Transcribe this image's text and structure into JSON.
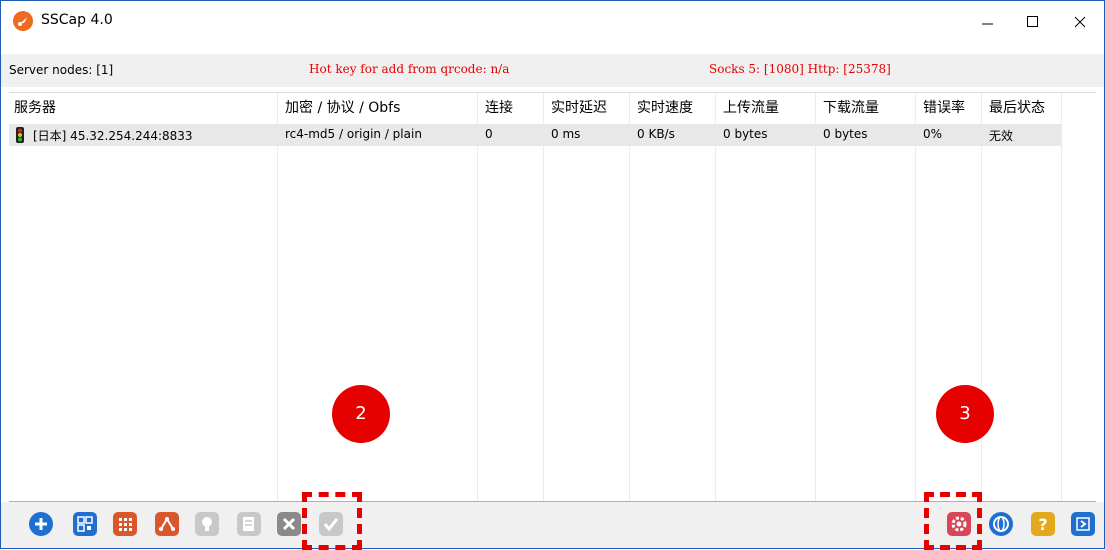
{
  "window": {
    "title": "SSCap 4.0"
  },
  "status": {
    "server_nodes": "Server nodes: [1]",
    "hotkey": "Hot key for add from qrcode: n/a",
    "ports": "Socks 5: [1080] Http: [25378]"
  },
  "table": {
    "columns": [
      "服务器",
      "加密 / 协议 / Obfs",
      "连接",
      "实时延迟",
      "实时速度",
      "上传流量",
      "下载流量",
      "错误率",
      "最后状态"
    ],
    "rows": [
      {
        "server": "[日本] 45.32.254.244:8833",
        "encryption": "rc4-md5 / origin / plain",
        "connections": "0",
        "latency": "0 ms",
        "speed": "0 KB/s",
        "upload": "0 bytes",
        "download": "0 bytes",
        "error_rate": "0%",
        "last_status": "无效"
      }
    ]
  },
  "annotations": {
    "marker_2": "2",
    "marker_3": "3"
  },
  "toolbar": {
    "icons": [
      "add-icon",
      "qrcode-icon",
      "grid-icon",
      "share-icon",
      "bulb-icon",
      "edit-icon",
      "delete-icon",
      "check-icon",
      "settings-icon",
      "globe-icon",
      "help-icon",
      "exit-icon"
    ]
  },
  "colors": {
    "accent": "#1e5fb4",
    "highlight_red": "#e60000",
    "app_orange": "#ee6a1e"
  }
}
